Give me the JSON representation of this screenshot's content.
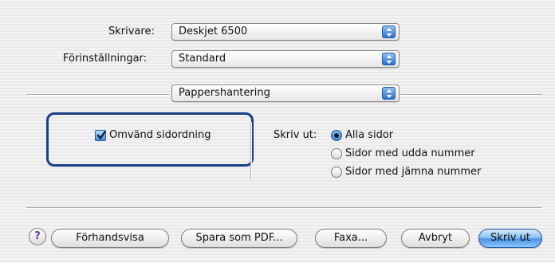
{
  "printer": {
    "label": "Skrivare:",
    "value": "Deskjet 6500"
  },
  "presets": {
    "label": "Förinställningar:",
    "value": "Standard"
  },
  "panel": {
    "value": "Pappershantering"
  },
  "reverse_order": {
    "label": "Omvänd sidordning",
    "checked": true
  },
  "print_pages": {
    "label": "Skriv ut:",
    "options": [
      "Alla sidor",
      "Sidor med udda nummer",
      "Sidor med jämna nummer"
    ],
    "selected": "Alla sidor"
  },
  "buttons": {
    "help": "?",
    "preview": "Förhandsvisa",
    "save_pdf": "Spara som PDF...",
    "fax": "Faxa...",
    "cancel": "Avbryt",
    "print": "Skriv ut"
  },
  "colors": {
    "highlight": "#163f86",
    "accent": "#3b82d6"
  }
}
